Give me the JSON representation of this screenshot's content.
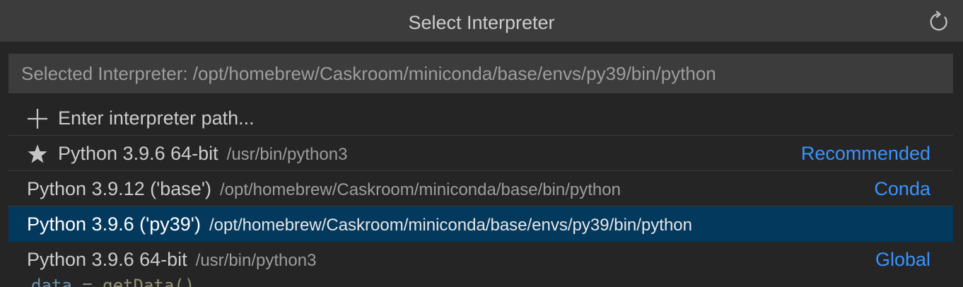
{
  "header": {
    "title": "Select Interpreter",
    "refresh_icon": "refresh-icon"
  },
  "input": {
    "value": "Selected Interpreter: /opt/homebrew/Caskroom/miniconda/base/envs/py39/bin/python"
  },
  "items": [
    {
      "icon": "plus-icon",
      "label": "Enter interpreter path...",
      "description": "",
      "badge": ""
    },
    {
      "icon": "star-icon",
      "label": "Python 3.9.6 64-bit",
      "description": "/usr/bin/python3",
      "badge": "Recommended"
    },
    {
      "icon": "",
      "label": "Python 3.9.12 ('base')",
      "description": "/opt/homebrew/Caskroom/miniconda/base/bin/python",
      "badge": "Conda"
    },
    {
      "icon": "",
      "label": "Python 3.9.6 ('py39')",
      "description": "/opt/homebrew/Caskroom/miniconda/base/envs/py39/bin/python",
      "badge": "",
      "selected": true
    },
    {
      "icon": "",
      "label": "Python 3.9.6 64-bit",
      "description": "/usr/bin/python3",
      "badge": "Global"
    }
  ],
  "editor_peek": {
    "var": "data",
    "op": "=",
    "call": "getData()"
  },
  "colors": {
    "accent": "#3794ff",
    "selection": "#04395e",
    "background": "#252526",
    "input_bg": "#3c3c3c"
  }
}
